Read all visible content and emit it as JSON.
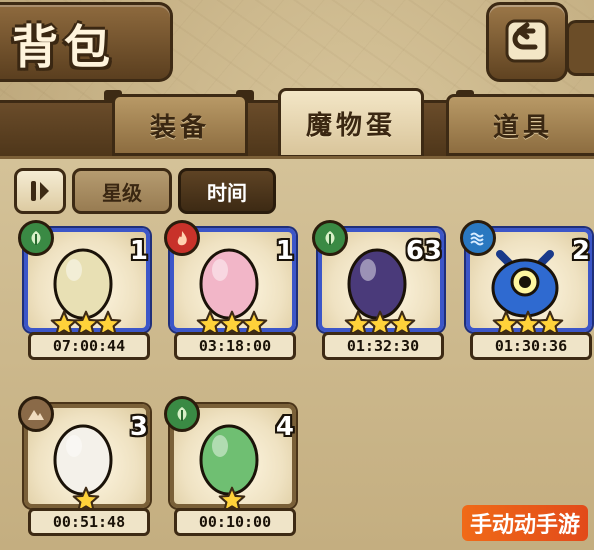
{
  "title": "背包",
  "tabs": [
    {
      "label": "装备",
      "active": false
    },
    {
      "label": "魔物蛋",
      "active": true
    },
    {
      "label": "道具",
      "active": false
    }
  ],
  "filters": {
    "sort_icon": "sort-toggle-icon",
    "star_label": "星级",
    "time_label": "时间",
    "active": "时间"
  },
  "eggs": [
    {
      "element": "grass",
      "count": "1",
      "stars": 3,
      "timer": "07:00:44",
      "color": "#e8e0b4"
    },
    {
      "element": "fire",
      "count": "1",
      "stars": 3,
      "timer": "03:18:00",
      "color": "#f2b6c8"
    },
    {
      "element": "grass",
      "count": "63",
      "stars": 3,
      "timer": "01:32:30",
      "color": "#4a3a7a"
    },
    {
      "element": "water",
      "count": "2",
      "stars": 3,
      "timer": "01:30:36",
      "color": "#2f6ad0"
    },
    {
      "element": "earth",
      "count": "3",
      "stars": 1,
      "timer": "00:51:48",
      "color": "#f4f1ea"
    },
    {
      "element": "grass",
      "count": "4",
      "stars": 1,
      "timer": "00:10:00",
      "color": "#6fbf72"
    }
  ],
  "watermark": "手动动手游"
}
